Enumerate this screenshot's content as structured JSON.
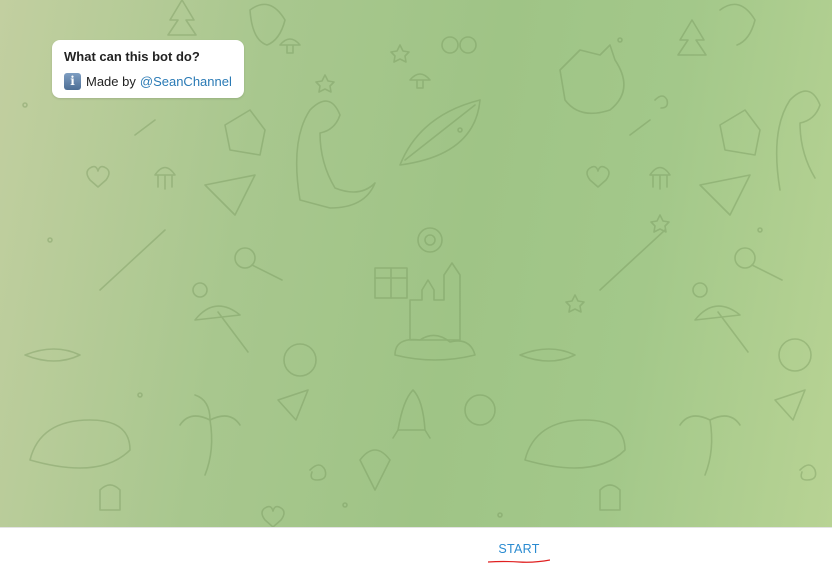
{
  "bot_info": {
    "title": "What can this bot do?",
    "made_by_label": "Made by",
    "channel_link": "@SeanChannel",
    "icon": "info-icon"
  },
  "composer": {
    "start_label": "START"
  },
  "colors": {
    "link": "#2a7ab5",
    "start_text": "#2a8bd1",
    "spellcheck_underline": "#e02020",
    "card_background": "#ffffff"
  }
}
